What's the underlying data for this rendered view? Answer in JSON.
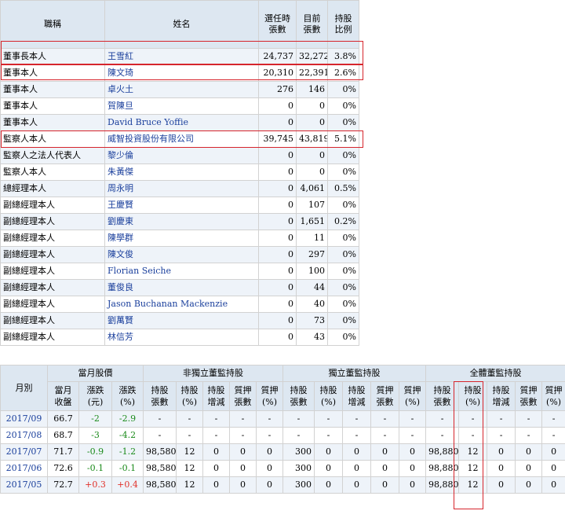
{
  "holders": {
    "headers": {
      "title": "職稱",
      "name": "姓名",
      "at_election": [
        "選任時",
        "張數"
      ],
      "current": [
        "目前",
        "張數"
      ],
      "ratio": [
        "持股",
        "比例"
      ]
    },
    "rows": [
      {
        "title": "董事長本人",
        "name": "王雪紅",
        "at_election": "24,737",
        "current": "32,272",
        "ratio": "3.8%"
      },
      {
        "title": "董事本人",
        "name": "陳文琦",
        "at_election": "20,310",
        "current": "22,391",
        "ratio": "2.6%"
      },
      {
        "title": "董事本人",
        "name": "卓火土",
        "at_election": "276",
        "current": "146",
        "ratio": "0%"
      },
      {
        "title": "董事本人",
        "name": "賀陳旦",
        "at_election": "0",
        "current": "0",
        "ratio": "0%"
      },
      {
        "title": "董事本人",
        "name": "David Bruce Yoffie",
        "at_election": "0",
        "current": "0",
        "ratio": "0%"
      },
      {
        "title": "監察人本人",
        "name": "威智投資股份有限公司",
        "at_election": "39,745",
        "current": "43,819",
        "ratio": "5.1%"
      },
      {
        "title": "監察人之法人代表人",
        "name": "黎少倫",
        "at_election": "0",
        "current": "0",
        "ratio": "0%"
      },
      {
        "title": "監察人本人",
        "name": "朱黃傑",
        "at_election": "0",
        "current": "0",
        "ratio": "0%"
      },
      {
        "title": "總經理本人",
        "name": "周永明",
        "at_election": "0",
        "current": "4,061",
        "ratio": "0.5%"
      },
      {
        "title": "副總經理本人",
        "name": "王慶賢",
        "at_election": "0",
        "current": "107",
        "ratio": "0%"
      },
      {
        "title": "副總經理本人",
        "name": "劉慶東",
        "at_election": "0",
        "current": "1,651",
        "ratio": "0.2%"
      },
      {
        "title": "副總經理本人",
        "name": "陳學群",
        "at_election": "0",
        "current": "11",
        "ratio": "0%"
      },
      {
        "title": "副總經理本人",
        "name": "陳文俊",
        "at_election": "0",
        "current": "297",
        "ratio": "0%"
      },
      {
        "title": "副總經理本人",
        "name": "Florian Seiche",
        "at_election": "0",
        "current": "100",
        "ratio": "0%"
      },
      {
        "title": "副總經理本人",
        "name": "董俊良",
        "at_election": "0",
        "current": "44",
        "ratio": "0%"
      },
      {
        "title": "副總經理本人",
        "name": "Jason Buchanan Mackenzie",
        "at_election": "0",
        "current": "40",
        "ratio": "0%"
      },
      {
        "title": "副總經理本人",
        "name": "劉萬賢",
        "at_election": "0",
        "current": "73",
        "ratio": "0%"
      },
      {
        "title": "副總經理本人",
        "name": "林信芳",
        "at_election": "0",
        "current": "43",
        "ratio": "0%"
      }
    ]
  },
  "monthly": {
    "group_headers": {
      "month": "月別",
      "price": "當月股價",
      "non_independent": "非獨立董監持股",
      "independent": "獨立董監持股",
      "all": "全體董監持股"
    },
    "sub_headers": {
      "price": [
        [
          "當月",
          "收盤"
        ],
        [
          "漲跌",
          "(元)"
        ],
        [
          "漲跌",
          "(%)"
        ]
      ],
      "group": [
        [
          "持股",
          "張數"
        ],
        [
          "持股",
          "(%)"
        ],
        [
          "持股",
          "增減"
        ],
        [
          "質押",
          "張數"
        ],
        [
          "質押",
          "(%)"
        ]
      ]
    },
    "rows": [
      {
        "month": "2017/09",
        "close": "66.7",
        "chg": "-2",
        "chg_pct": "-2.9",
        "dir": "down",
        "non_ind": [
          "-",
          "-",
          "-",
          "-",
          "-"
        ],
        "ind": [
          "-",
          "-",
          "-",
          "-",
          "-"
        ],
        "all": [
          "-",
          "-",
          "-",
          "-",
          "-"
        ]
      },
      {
        "month": "2017/08",
        "close": "68.7",
        "chg": "-3",
        "chg_pct": "-4.2",
        "dir": "down",
        "non_ind": [
          "-",
          "-",
          "-",
          "-",
          "-"
        ],
        "ind": [
          "-",
          "-",
          "-",
          "-",
          "-"
        ],
        "all": [
          "-",
          "-",
          "-",
          "-",
          "-"
        ]
      },
      {
        "month": "2017/07",
        "close": "71.7",
        "chg": "-0.9",
        "chg_pct": "-1.2",
        "dir": "down",
        "non_ind": [
          "98,580",
          "12",
          "0",
          "0",
          "0"
        ],
        "ind": [
          "300",
          "0",
          "0",
          "0",
          "0"
        ],
        "all": [
          "98,880",
          "12",
          "0",
          "0",
          "0"
        ]
      },
      {
        "month": "2017/06",
        "close": "72.6",
        "chg": "-0.1",
        "chg_pct": "-0.1",
        "dir": "down",
        "non_ind": [
          "98,580",
          "12",
          "0",
          "0",
          "0"
        ],
        "ind": [
          "300",
          "0",
          "0",
          "0",
          "0"
        ],
        "all": [
          "98,880",
          "12",
          "0",
          "0",
          "0"
        ]
      },
      {
        "month": "2017/05",
        "close": "72.7",
        "chg": "+0.3",
        "chg_pct": "+0.4",
        "dir": "up",
        "non_ind": [
          "98,580",
          "12",
          "0",
          "0",
          "0"
        ],
        "ind": [
          "300",
          "0",
          "0",
          "0",
          "0"
        ],
        "all": [
          "98,880",
          "12",
          "0",
          "0",
          "0"
        ]
      }
    ]
  },
  "colors": {
    "link": "#1a3f9c",
    "header_bg": "#dde7f1",
    "highlight": "#d6252c",
    "up": "#e0312a",
    "down": "#1a8a1a"
  }
}
